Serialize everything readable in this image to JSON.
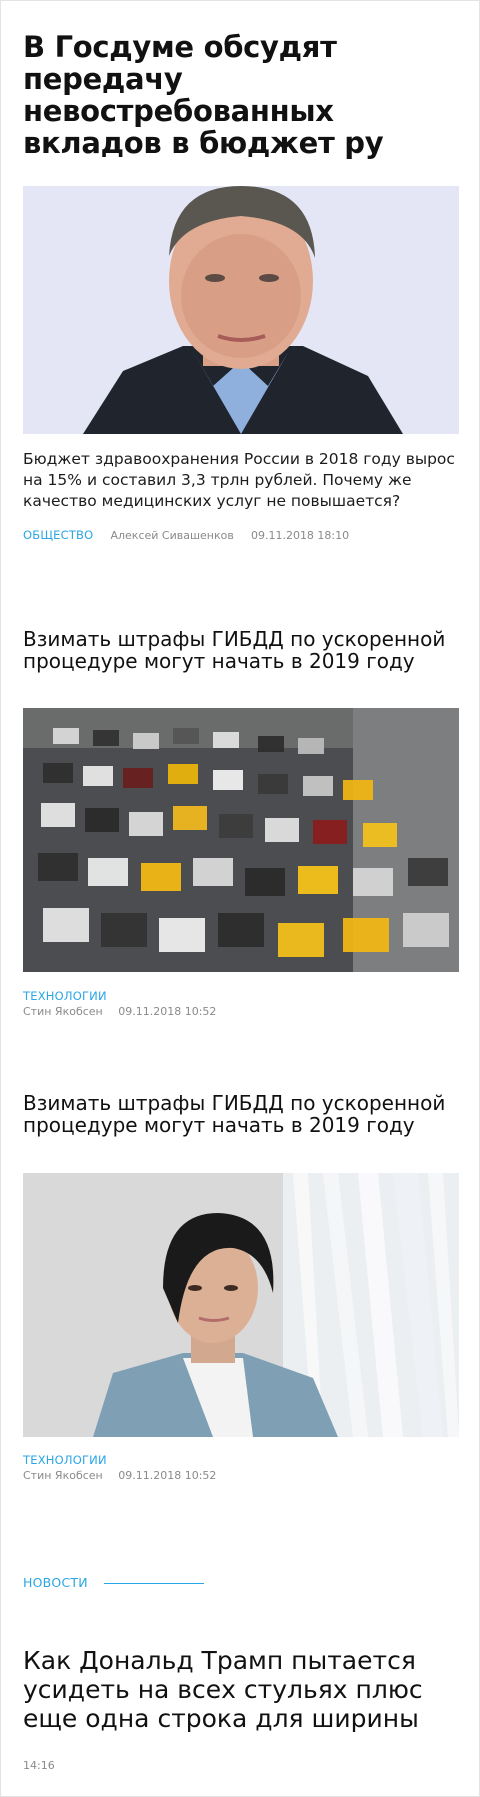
{
  "article_main": {
    "title": "В Госдуме обсудят передачу невостребованных вкладов в бюджет ру",
    "lead": "Бюджет здравоохранения России в 2018 году вырос на 15% и составил 3,3 трлн рублей. Почему же качество медицинских услуг не повышается?",
    "rubric": "ОБЩЕСТВО",
    "author": "Алексей Сивашенков",
    "date": "09.11.2018 18:10"
  },
  "article_2": {
    "title": "Взимать штрафы ГИБДД по ускоренной процедуре могут начать в 2019 году",
    "rubric": "ТЕХНОЛОГИИ",
    "author": "Стин Якобсен",
    "date": "09.11.2018 10:52"
  },
  "article_3": {
    "title": "Взимать штрафы ГИБДД по ускоренной процедуре могут начать в 2019 году",
    "rubric": "ТЕХНОЛОГИИ",
    "author": "Стин Якобсен",
    "date": "09.11.2018 10:52"
  },
  "news_section": {
    "label": "НОВОСТИ",
    "title": "Как Дональд Трамп пытается усидеть на всех стульях плюс еще одна строка для ширины",
    "time": "14:16"
  },
  "colors": {
    "accent": "#2aa6e6",
    "meta_gray": "#8a8a8a"
  }
}
